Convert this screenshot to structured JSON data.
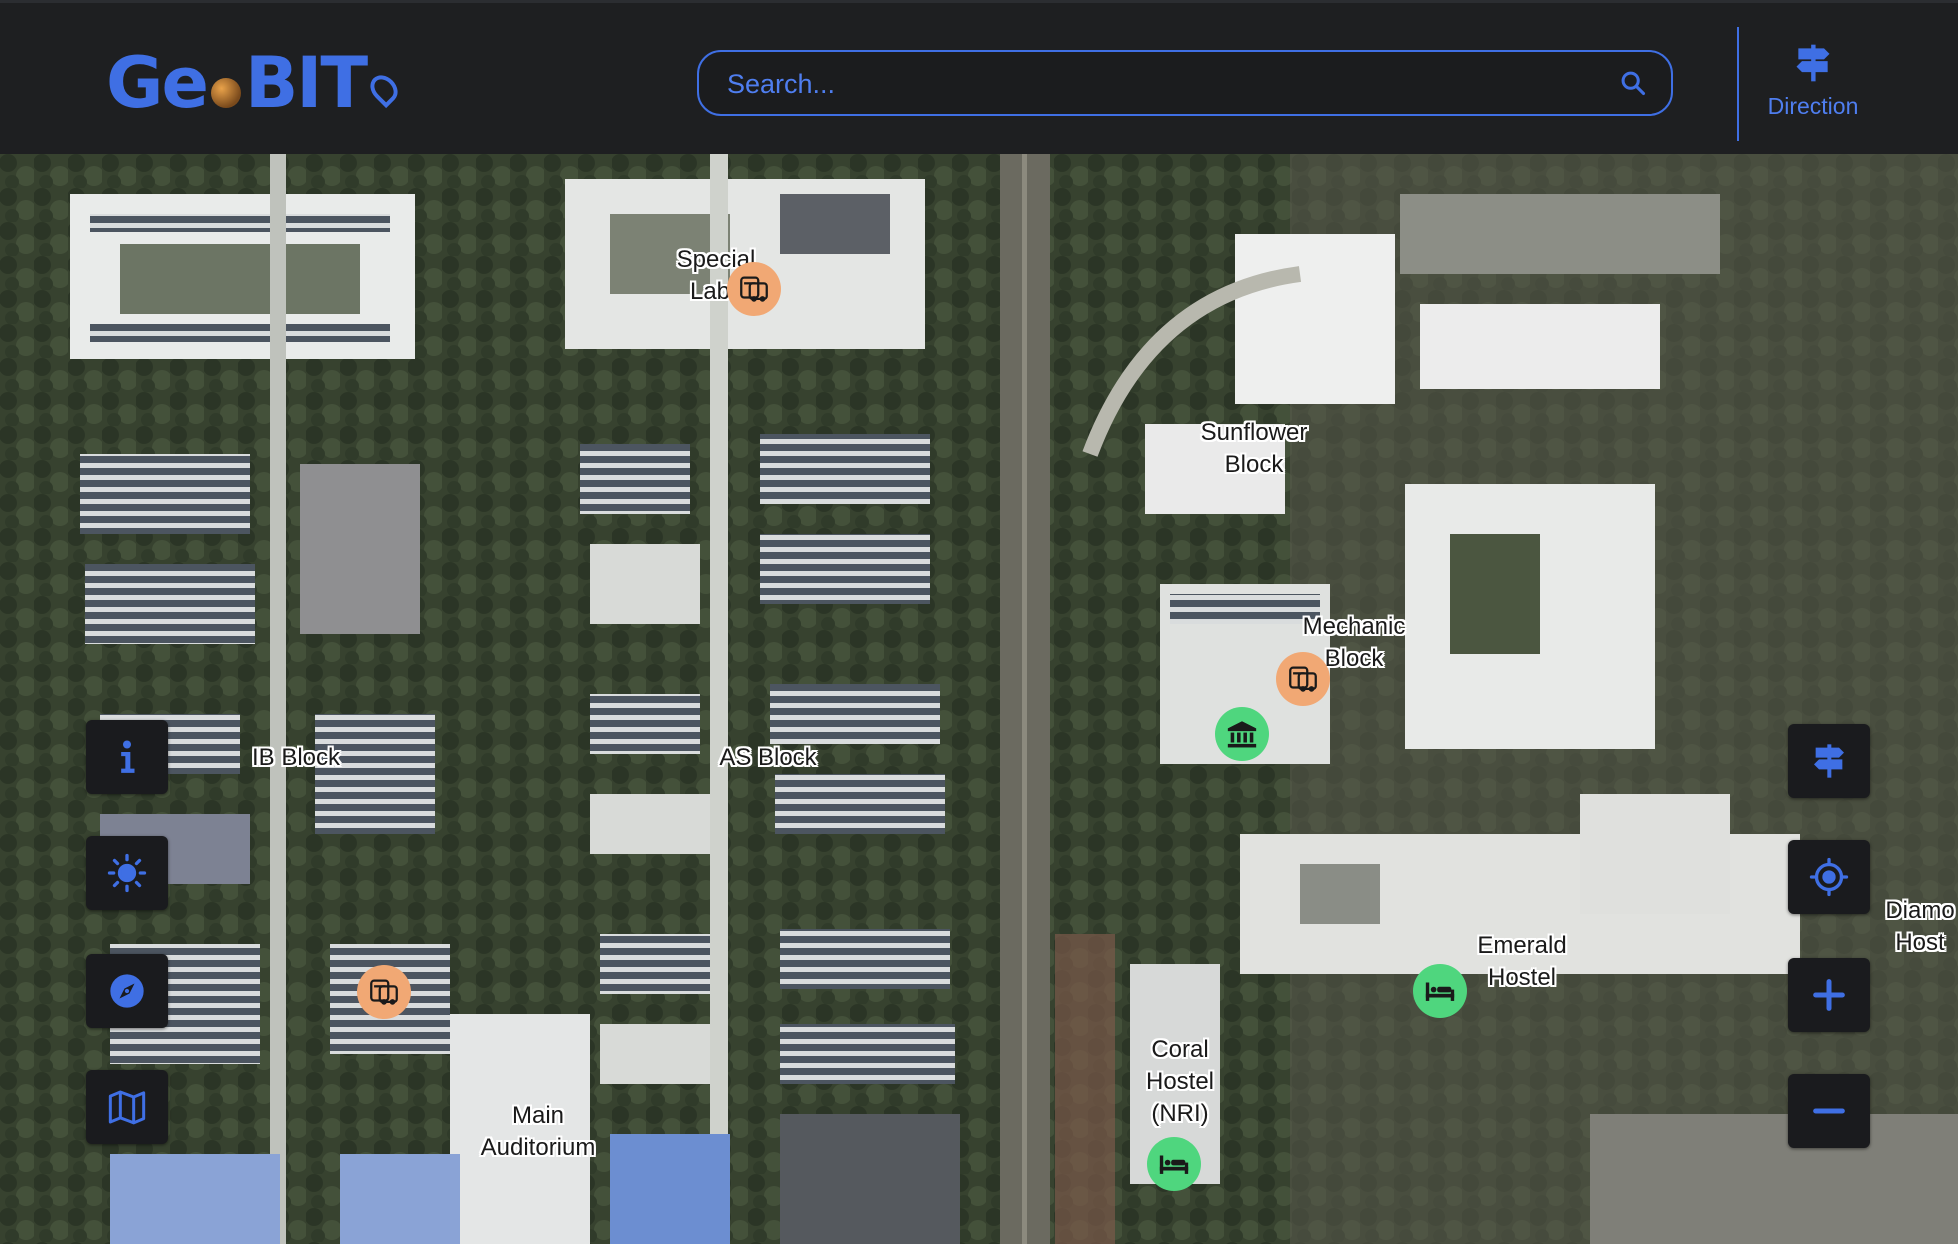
{
  "app": {
    "logo_text_1": "Ge",
    "logo_text_2": "BIT",
    "logo_alt": "GeoBIT"
  },
  "search": {
    "placeholder": "Search...",
    "icon": "search-icon"
  },
  "header": {
    "direction_label": "Direction",
    "direction_icon": "signpost-icon"
  },
  "left_controls": [
    {
      "name": "info",
      "icon": "info-icon"
    },
    {
      "name": "theme",
      "icon": "sun-icon"
    },
    {
      "name": "compass",
      "icon": "compass-icon"
    },
    {
      "name": "map-layers",
      "icon": "map-icon"
    }
  ],
  "right_controls": [
    {
      "name": "directions",
      "icon": "signpost-icon"
    },
    {
      "name": "locate",
      "icon": "crosshair-icon"
    },
    {
      "name": "zoom-in",
      "icon": "plus-icon"
    },
    {
      "name": "zoom-out",
      "icon": "minus-icon"
    }
  ],
  "map_labels": {
    "special_labs": "Special\nLabs",
    "sunflower_block": "Sunflower\nBlock",
    "mechanic_block": "Mechanic\nBlock",
    "ib_block": "IB Block",
    "as_block": "AS Block",
    "emerald_hostel": "Emerald\nHostel",
    "diamond_hostel": "Diamo\nHost",
    "coral_hostel": "Coral\nHostel\n(NRI)",
    "main_auditorium": "Main\nAuditorium"
  },
  "markers": [
    {
      "type": "bus-icon",
      "color": "#f1a874"
    },
    {
      "type": "bus-icon",
      "color": "#f1a874"
    },
    {
      "type": "bus-icon",
      "color": "#f1a874"
    },
    {
      "type": "bank-icon",
      "color": "#4fd67e"
    },
    {
      "type": "bed-icon",
      "color": "#4fd67e"
    },
    {
      "type": "bed-icon",
      "color": "#4fd67e"
    }
  ],
  "colors": {
    "accent": "#3f6fe4",
    "header_bg": "#1e1f21",
    "bus_marker": "#f1a874",
    "green_marker": "#4fd67e"
  }
}
